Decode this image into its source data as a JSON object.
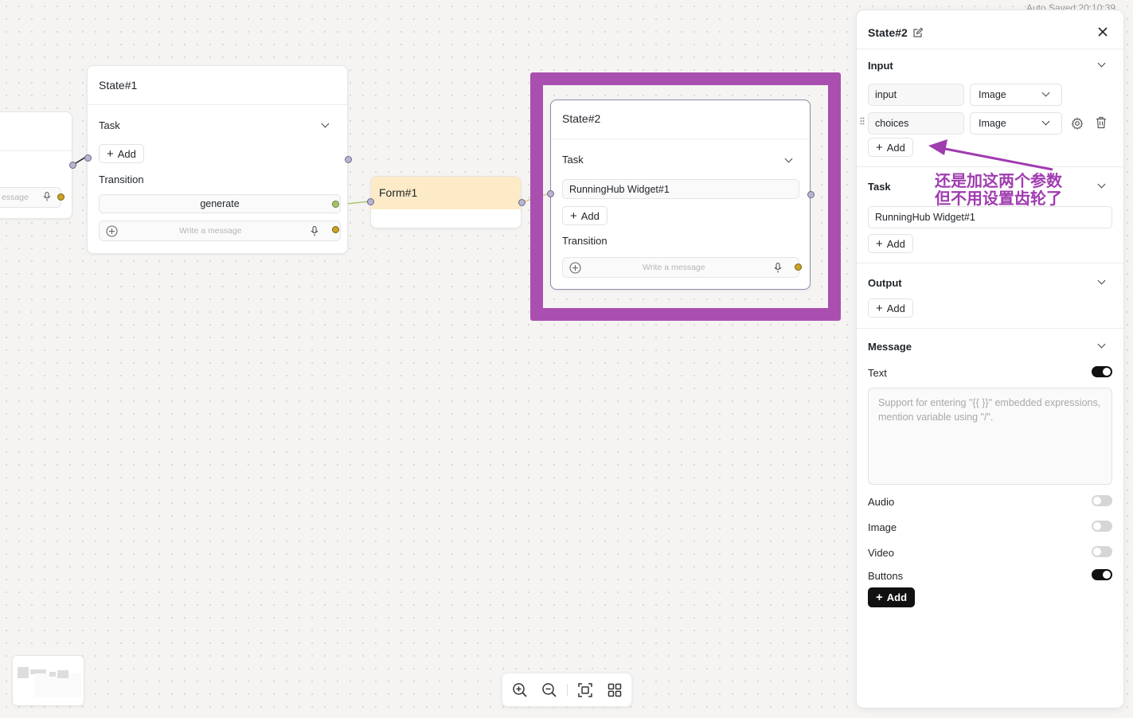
{
  "canvas": {
    "autosave_text": "Auto Saved 20:10:39",
    "left_node": {
      "message_placeholder": "essage"
    },
    "state1": {
      "title": "State#1",
      "task_label": "Task",
      "add_label": "Add",
      "transition_label": "Transition",
      "transition_value": "generate",
      "message_placeholder": "Write a message"
    },
    "form1": {
      "title": "Form#1"
    },
    "state2": {
      "title": "State#2",
      "task_label": "Task",
      "task_value": "RunningHub Widget#1",
      "add_label": "Add",
      "transition_label": "Transition",
      "message_placeholder": "Write a message"
    },
    "highlight_color": "#a94fb0"
  },
  "annotation": {
    "line1": "还是加这两个参数",
    "line2": "但不用设置齿轮了",
    "color": "#a03cb0"
  },
  "panel": {
    "title": "State#2",
    "input": {
      "title": "Input",
      "rows": [
        {
          "name": "input",
          "type": "Image"
        },
        {
          "name": "choices",
          "type": "Image"
        }
      ],
      "add_label": "Add"
    },
    "task": {
      "title": "Task",
      "value": "RunningHub Widget#1",
      "add_label": "Add"
    },
    "output": {
      "title": "Output",
      "add_label": "Add"
    },
    "message": {
      "title": "Message",
      "text_label": "Text",
      "text_on": true,
      "textarea_placeholder": "Support for entering \"{{ }}\" embedded expressions, mention variable using \"/\".",
      "audio_label": "Audio",
      "audio_on": false,
      "image_label": "Image",
      "image_on": false,
      "video_label": "Video",
      "video_on": false,
      "buttons_label": "Buttons",
      "buttons_on": true,
      "add_label": "Add"
    }
  },
  "toolbar": {
    "icons": [
      "zoom-in-icon",
      "zoom-out-icon",
      "fit-view-icon",
      "layout-grid-icon"
    ]
  }
}
